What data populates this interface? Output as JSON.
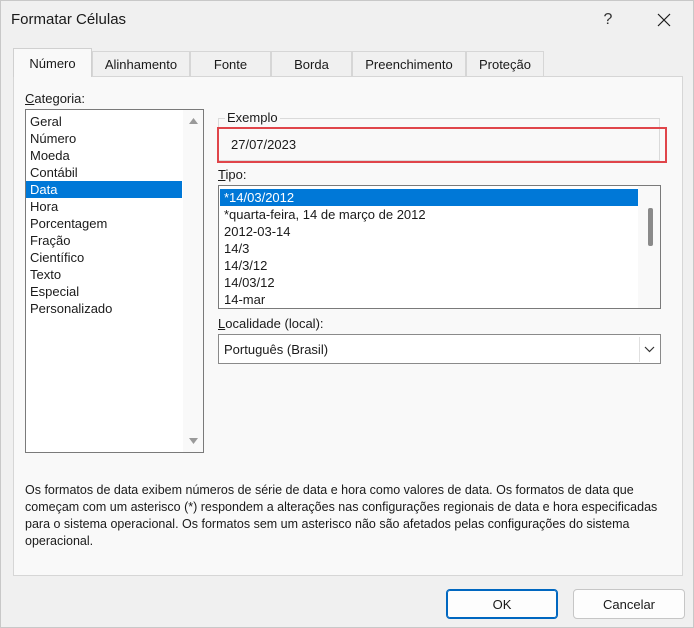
{
  "window": {
    "title": "Formatar Células",
    "help_glyph": "?"
  },
  "tabs": [
    {
      "label": "Número",
      "active": true
    },
    {
      "label": "Alinhamento",
      "active": false
    },
    {
      "label": "Fonte",
      "active": false
    },
    {
      "label": "Borda",
      "active": false
    },
    {
      "label": "Preenchimento",
      "active": false
    },
    {
      "label": "Proteção",
      "active": false
    }
  ],
  "category": {
    "label_prefix": "",
    "label_underlined": "C",
    "label_rest": "ategoria:",
    "items": [
      "Geral",
      "Número",
      "Moeda",
      "Contábil",
      "Data",
      "Hora",
      "Porcentagem",
      "Fração",
      "Científico",
      "Texto",
      "Especial",
      "Personalizado"
    ],
    "selected": "Data"
  },
  "sample": {
    "legend": "Exemplo",
    "value": "27/07/2023"
  },
  "type": {
    "label_underlined": "T",
    "label_rest": "ipo:",
    "items": [
      "*14/03/2012",
      "*quarta-feira, 14 de março de 2012",
      "2012-03-14",
      "14/3",
      "14/3/12",
      "14/03/12",
      "14-mar"
    ],
    "selected": "*14/03/2012"
  },
  "locale": {
    "label_underlined": "L",
    "label_rest": "ocalidade (local):",
    "value": "Português (Brasil)"
  },
  "description": "Os formatos de data exibem números de série de data e hora como valores de data. Os formatos de data que começam com um asterisco (*) respondem a alterações nas configurações regionais de data e hora especificadas para o sistema operacional. Os formatos sem um asterisco não são afetados pelas configurações do sistema operacional.",
  "buttons": {
    "ok": "OK",
    "cancel": "Cancelar"
  },
  "colors": {
    "selection": "#0078d7",
    "highlight_border": "#e0454a",
    "primary_border": "#0067c0"
  }
}
